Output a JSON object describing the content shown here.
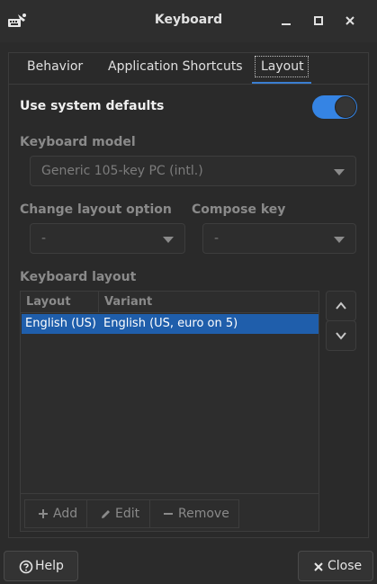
{
  "window": {
    "title": "Keyboard",
    "icons": {
      "app": "keyboard-settings-icon",
      "minimize": "minimize-icon",
      "maximize": "maximize-icon",
      "close": "close-icon"
    }
  },
  "tabs": [
    {
      "label": "Behavior",
      "active": false
    },
    {
      "label": "Application Shortcuts",
      "active": false
    },
    {
      "label": "Layout",
      "active": true
    }
  ],
  "layout_tab": {
    "use_system_defaults": {
      "label": "Use system defaults",
      "enabled": true
    },
    "keyboard_model": {
      "label": "Keyboard model",
      "value": "Generic 105-key PC (intl.)"
    },
    "change_layout_option": {
      "label": "Change layout option",
      "value": "-"
    },
    "compose_key": {
      "label": "Compose key",
      "value": "-"
    },
    "keyboard_layout": {
      "label": "Keyboard layout",
      "columns": [
        "Layout",
        "Variant"
      ],
      "rows": [
        {
          "layout": "English (US)",
          "variant": "English (US, euro on 5)",
          "selected": true
        }
      ],
      "buttons": {
        "add": "Add",
        "edit": "Edit",
        "remove": "Remove"
      }
    }
  },
  "footer": {
    "help": "Help",
    "close": "Close"
  },
  "colors": {
    "accent": "#3584e4",
    "selection": "#1f5eab",
    "background": "#2b2b2b"
  }
}
